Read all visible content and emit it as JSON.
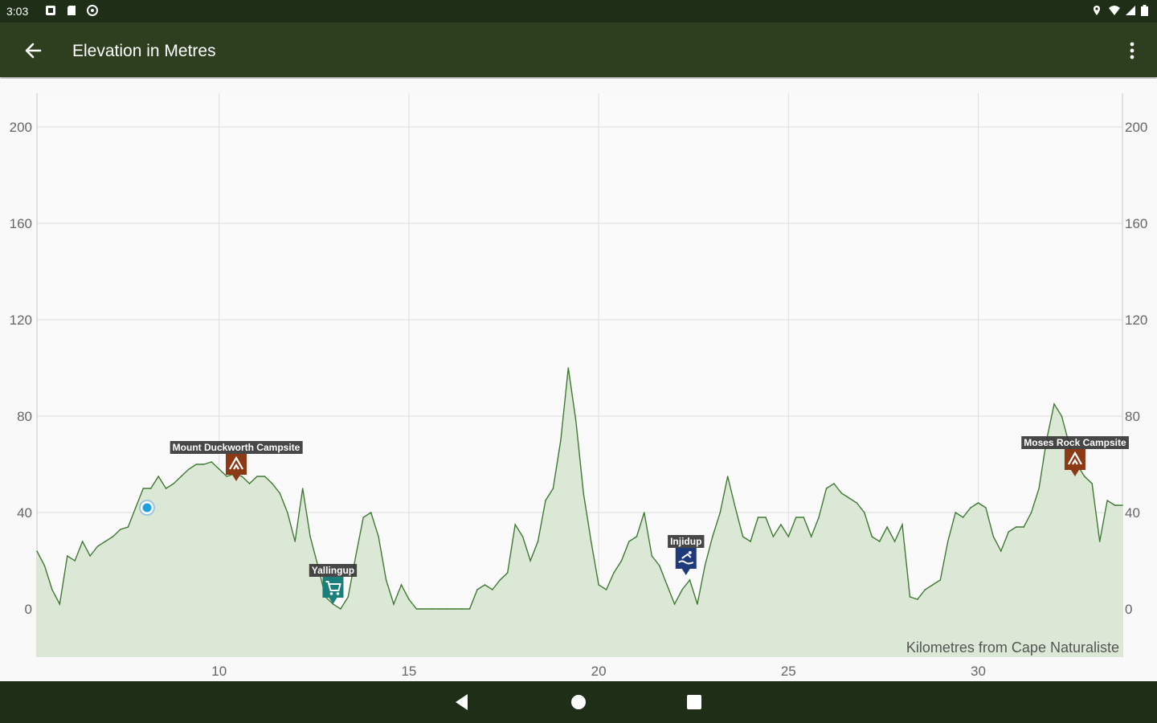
{
  "status_bar": {
    "time": "3:03",
    "left_icons": [
      "notification-icon",
      "sd-card-icon",
      "sync-icon"
    ],
    "right_icons": [
      "location-icon",
      "wifi-icon",
      "signal-icon",
      "battery-icon"
    ]
  },
  "app_bar": {
    "title": "Elevation in Metres",
    "back_icon": "arrow-back-icon",
    "menu_icon": "more-vert-icon"
  },
  "chart_data": {
    "type": "area",
    "title": "",
    "xlabel": "Kilometres from Cape Naturaliste",
    "ylabel": "",
    "xlim": [
      5.2,
      33.8
    ],
    "ylim": [
      -20,
      214
    ],
    "x_ticks": [
      10,
      15,
      20,
      25,
      30
    ],
    "y_ticks": [
      0,
      40,
      80,
      120,
      160,
      200
    ],
    "y_axis_both_sides": true,
    "grid": true,
    "colors": {
      "line": "#3f7a33",
      "fill": "#dbe8d5"
    },
    "series": [
      {
        "x": [
          5.2,
          5.4,
          5.6,
          5.8,
          6.0,
          6.2,
          6.4,
          6.6,
          6.8,
          7.0,
          7.2,
          7.4,
          7.6,
          7.8,
          8.0,
          8.2,
          8.4,
          8.6,
          8.8,
          9.0,
          9.2,
          9.4,
          9.6,
          9.8,
          10.0,
          10.2,
          10.4,
          10.6,
          10.8,
          11.0,
          11.2,
          11.4,
          11.6,
          11.8,
          12.0,
          12.2,
          12.4,
          12.6,
          12.8,
          13.0,
          13.2,
          13.4,
          13.6,
          13.8,
          14.0,
          14.2,
          14.4,
          14.6,
          14.8,
          15.0,
          15.2,
          15.4,
          15.6,
          15.8,
          16.0,
          16.2,
          16.4,
          16.6,
          16.8,
          17.0,
          17.2,
          17.4,
          17.6,
          17.8,
          18.0,
          18.2,
          18.4,
          18.6,
          18.8,
          19.0,
          19.2,
          19.4,
          19.6,
          19.8,
          20.0,
          20.2,
          20.4,
          20.6,
          20.8,
          21.0,
          21.2,
          21.4,
          21.6,
          21.8,
          22.0,
          22.2,
          22.4,
          22.6,
          22.8,
          23.0,
          23.2,
          23.4,
          23.6,
          23.8,
          24.0,
          24.2,
          24.4,
          24.6,
          24.8,
          25.0,
          25.2,
          25.4,
          25.6,
          25.8,
          26.0,
          26.2,
          26.4,
          26.6,
          26.8,
          27.0,
          27.2,
          27.4,
          27.6,
          27.8,
          28.0,
          28.2,
          28.4,
          28.6,
          28.8,
          29.0,
          29.2,
          29.4,
          29.6,
          29.8,
          30.0,
          30.2,
          30.4,
          30.6,
          30.8,
          31.0,
          31.2,
          31.4,
          31.6,
          31.8,
          32.0,
          32.2,
          32.4,
          32.6,
          32.8,
          33.0,
          33.2,
          33.4,
          33.6,
          33.8
        ],
        "y": [
          24,
          18,
          8,
          2,
          22,
          20,
          28,
          22,
          26,
          28,
          30,
          33,
          34,
          42,
          50,
          50,
          55,
          50,
          52,
          55,
          58,
          60,
          60,
          61,
          58,
          55,
          56,
          55,
          52,
          55,
          55,
          52,
          48,
          40,
          28,
          50,
          30,
          18,
          5,
          2,
          0,
          5,
          22,
          38,
          40,
          30,
          12,
          2,
          10,
          4,
          0,
          0,
          0,
          0,
          0,
          0,
          0,
          0,
          8,
          10,
          8,
          12,
          15,
          35,
          30,
          20,
          28,
          45,
          50,
          70,
          100,
          78,
          48,
          28,
          10,
          8,
          15,
          20,
          28,
          30,
          40,
          22,
          18,
          10,
          2,
          8,
          12,
          2,
          18,
          30,
          40,
          55,
          42,
          30,
          28,
          38,
          38,
          30,
          35,
          30,
          38,
          38,
          30,
          38,
          50,
          52,
          48,
          46,
          44,
          40,
          30,
          28,
          34,
          28,
          35,
          5,
          4,
          8,
          10,
          12,
          28,
          40,
          38,
          42,
          44,
          42,
          30,
          24,
          32,
          34,
          34,
          40,
          50,
          70,
          85,
          80,
          68,
          60,
          55,
          52,
          28,
          45,
          43,
          43
        ],
        "label_values": [],
        "markers": [
          {
            "x": 8.1,
            "y": 42,
            "label": ""
          }
        ]
      }
    ],
    "annotations": [
      {
        "x": 10.45,
        "y": 53,
        "label": "Mount Duckworth Campsite",
        "icon": "campsite-icon",
        "color": "#8b3a15"
      },
      {
        "x": 13.0,
        "y": 2,
        "label": "Yallingup",
        "icon": "shopping-cart-icon",
        "color": "#1a7f7a"
      },
      {
        "x": 22.3,
        "y": 14,
        "label": "Injidup",
        "icon": "swimming-icon",
        "color": "#1f3a7a"
      },
      {
        "x": 32.55,
        "y": 55,
        "label": "Moses Rock Campsite",
        "icon": "campsite-icon",
        "color": "#8b3a15"
      }
    ]
  },
  "nav_bar": {
    "back_icon": "nav-back-icon",
    "home_icon": "nav-home-icon",
    "recents_icon": "nav-recents-icon"
  }
}
